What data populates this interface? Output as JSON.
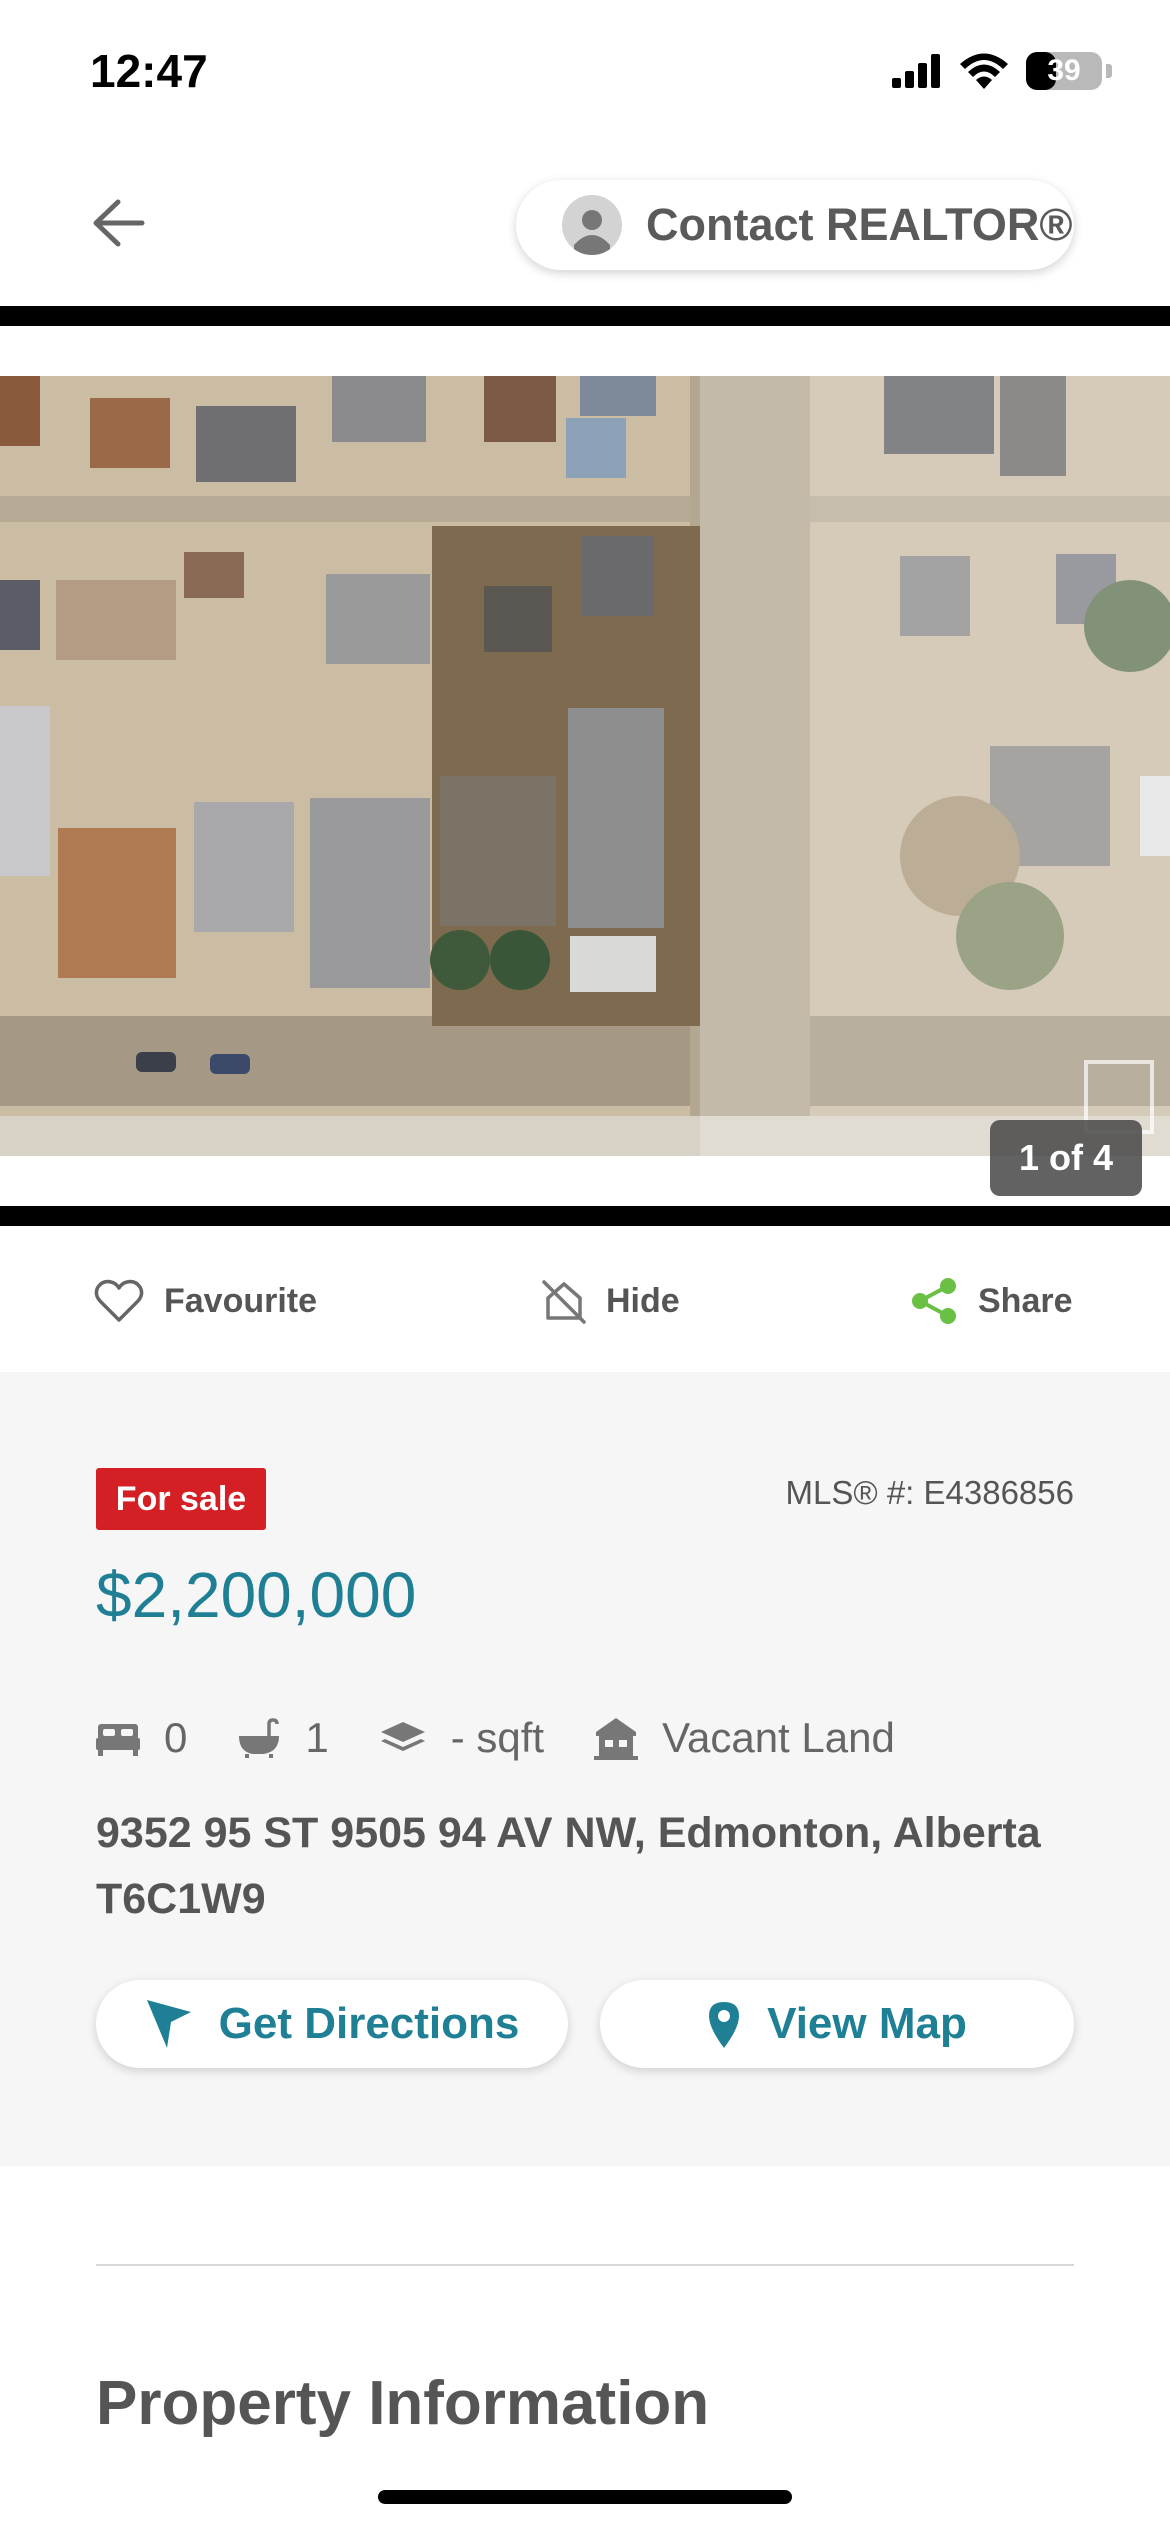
{
  "status_bar": {
    "time": "12:47",
    "battery_percent": "39",
    "battery_level": 0.39
  },
  "header": {
    "back_icon": "arrow-left-icon",
    "contact_label": "Contact REALTOR®"
  },
  "photo": {
    "counter": "1 of 4"
  },
  "actions": {
    "favourite": "Favourite",
    "hide": "Hide",
    "share": "Share"
  },
  "listing": {
    "status_badge": "For sale",
    "mls": "MLS® #: E4386856",
    "price": "$2,200,000",
    "bedrooms": "0",
    "bathrooms": "1",
    "sqft": "- sqft",
    "property_type": "Vacant Land",
    "address": "9352 95 ST 9505 94 AV NW, Edmonton, Alberta T6C1W9",
    "directions_label": "Get Directions",
    "map_label": "View Map"
  },
  "sections": {
    "property_information": "Property Information"
  },
  "colors": {
    "accent": "#1e7f95",
    "sale_red": "#d41f24",
    "share_green": "#6abf45"
  }
}
